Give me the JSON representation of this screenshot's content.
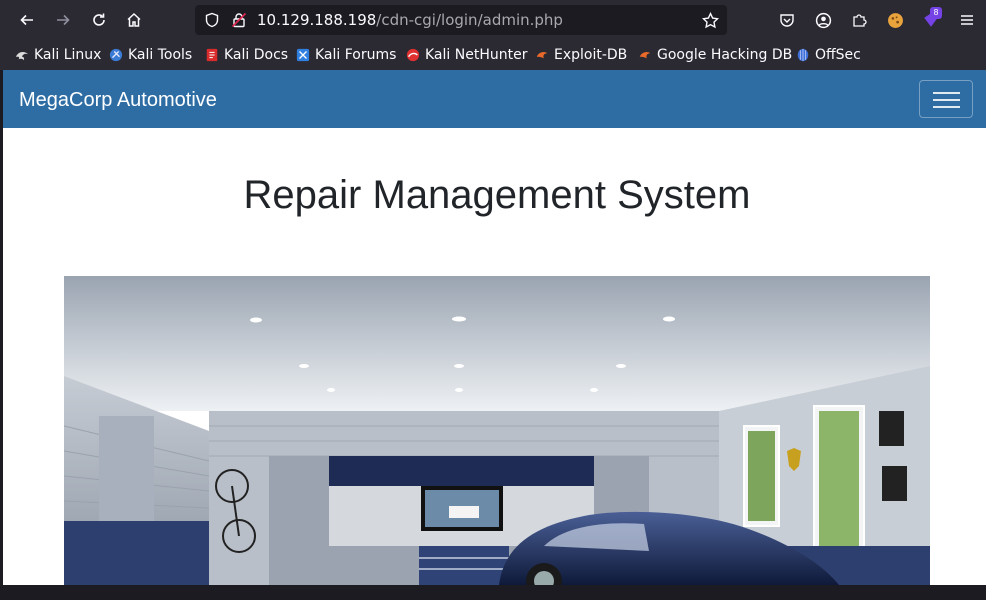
{
  "browser": {
    "url": {
      "host": "10.129.188.198",
      "path": "/cdn-cgi/login/admin.php"
    },
    "extension_badge": "8",
    "bookmarks": [
      {
        "label": "Kali Linux",
        "icon": "kali-dragon-icon"
      },
      {
        "label": "Kali Tools",
        "icon": "kali-tools-icon"
      },
      {
        "label": "Kali Docs",
        "icon": "kali-docs-icon"
      },
      {
        "label": "Kali Forums",
        "icon": "kali-forums-icon"
      },
      {
        "label": "Kali NetHunter",
        "icon": "kali-nethunter-icon"
      },
      {
        "label": "Exploit-DB",
        "icon": "exploit-db-icon"
      },
      {
        "label": "Google Hacking DB",
        "icon": "ghdb-icon"
      },
      {
        "label": "OffSec",
        "icon": "offsec-icon"
      }
    ]
  },
  "page": {
    "navbar": {
      "brand": "MegaCorp Automotive"
    },
    "heading": "Repair Management System",
    "hero_image": "garage-with-car-image"
  },
  "colors": {
    "navbar": "#2e6da4",
    "browser_chrome": "#2b2a33",
    "heading_text": "#212529"
  }
}
